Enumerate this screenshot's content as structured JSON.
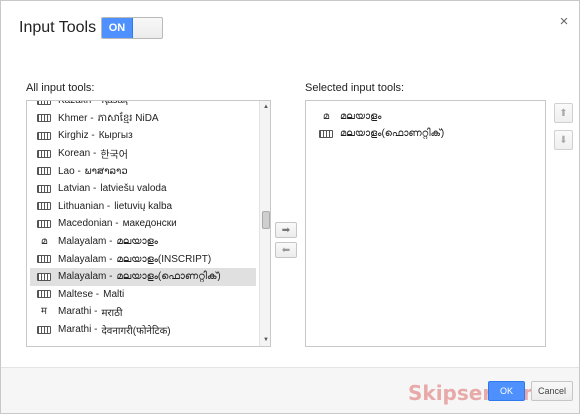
{
  "dialog": {
    "title": "Input Tools",
    "toggle_label": "ON",
    "close_glyph": "×"
  },
  "all_tools": {
    "label": "All input tools:",
    "items": [
      {
        "icon": "keyboard-icon",
        "language": "Kazakh -",
        "native": "Қазақ"
      },
      {
        "icon": "keyboard-icon",
        "language": "Khmer -",
        "native": "ភាសាខ្មែរ NiDA"
      },
      {
        "icon": "keyboard-icon",
        "language": "Kirghiz -",
        "native": "Кыргыз"
      },
      {
        "icon": "keyboard-icon",
        "language": "Korean -",
        "native": "한국어"
      },
      {
        "icon": "keyboard-icon",
        "language": "Lao -",
        "native": "ພາສາລາວ"
      },
      {
        "icon": "keyboard-icon",
        "language": "Latvian -",
        "native": "latviešu valoda"
      },
      {
        "icon": "keyboard-icon",
        "language": "Lithuanian -",
        "native": "lietuvių kalba"
      },
      {
        "icon": "keyboard-icon",
        "language": "Macedonian -",
        "native": "македонски"
      },
      {
        "icon": "transliteration-icon",
        "glyph": "മ",
        "language": "Malayalam -",
        "native": "മലയാളം"
      },
      {
        "icon": "keyboard-icon",
        "language": "Malayalam -",
        "native": "മലയാളം(INSCRIPT)"
      },
      {
        "icon": "keyboard-icon",
        "language": "Malayalam -",
        "native": "മലയാളം(ഫൊണറ്റിക്)",
        "selected": true
      },
      {
        "icon": "keyboard-icon",
        "language": "Maltese -",
        "native": "Malti"
      },
      {
        "icon": "transliteration-icon",
        "glyph": "म",
        "language": "Marathi -",
        "native": "मराठी"
      },
      {
        "icon": "keyboard-icon",
        "language": "Marathi -",
        "native": "देवनागरी(फोनेटिक)"
      }
    ]
  },
  "selected_tools": {
    "label": "Selected input tools:",
    "items": [
      {
        "icon": "transliteration-icon",
        "glyph": "മ",
        "native": "മലയാളം"
      },
      {
        "icon": "keyboard-icon",
        "native": "മലയാളം(ഫൊണറ്റിക്)"
      }
    ]
  },
  "controls": {
    "move_right_glyph": "➡",
    "move_left_glyph": "⬅",
    "move_up_glyph": "⬆",
    "move_down_glyph": "⬇",
    "scroll_up_glyph": "▲",
    "scroll_down_glyph": "▼"
  },
  "footer": {
    "ok_label": "OK",
    "cancel_label": "Cancel",
    "watermark": "Skipser.com"
  },
  "colors": {
    "accent": "#4d90fe",
    "selected_row": "#e0e0e0"
  }
}
